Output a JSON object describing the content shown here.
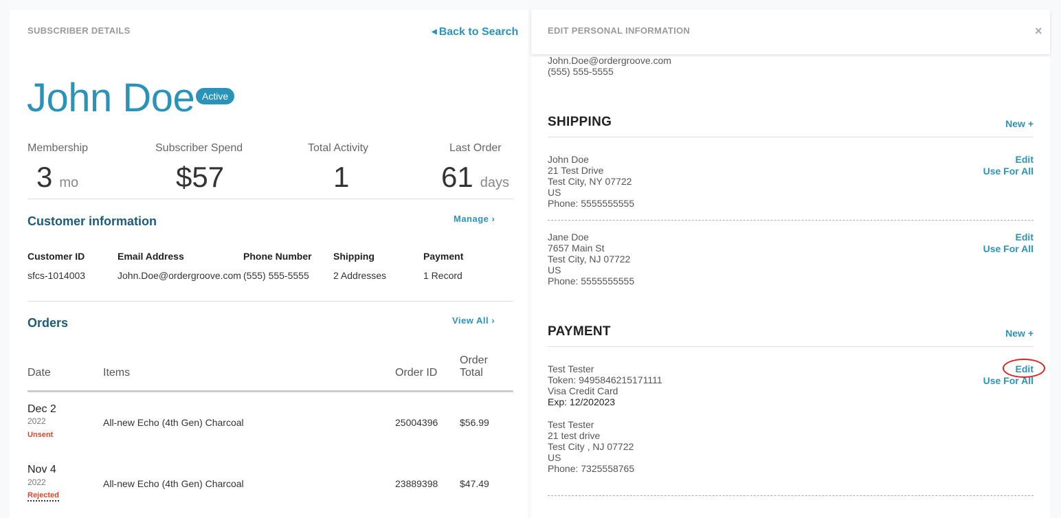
{
  "left": {
    "section_label": "SUBSCRIBER DETAILS",
    "back_link": "Back to Search",
    "name": "John Doe",
    "status": "Active",
    "stats": [
      {
        "label": "Membership",
        "value": "3",
        "unit": "mo"
      },
      {
        "label": "Subscriber Spend",
        "value": "$57",
        "unit": ""
      },
      {
        "label": "Total Activity",
        "value": "1",
        "unit": ""
      },
      {
        "label": "Last Order",
        "value": "61",
        "unit": "days"
      }
    ],
    "customer_info": {
      "title": "Customer information",
      "manage": "Manage  ›",
      "headers": [
        "Customer ID",
        "Email Address",
        "Phone Number",
        "Shipping",
        "Payment"
      ],
      "values": [
        "sfcs-1014003",
        "John.Doe@ordergroove.com",
        "(555) 555-5555",
        "2 Addresses",
        "1 Record"
      ]
    },
    "orders": {
      "title": "Orders",
      "view_all": "View All  ›",
      "headers": {
        "date": "Date",
        "items": "Items",
        "order_id": "Order ID",
        "order_total_1": "Order",
        "order_total_2": "Total"
      },
      "rows": [
        {
          "date": "Dec 2",
          "year": "2022",
          "status": "Unsent",
          "item": "All-new Echo (4th Gen) Charcoal",
          "order_id": "25004396",
          "total": "$56.99"
        },
        {
          "date": "Nov 4",
          "year": "2022",
          "status": "Rejected",
          "item": "All-new Echo (4th Gen) Charcoal",
          "order_id": "23889398",
          "total": "$47.49"
        }
      ]
    }
  },
  "right": {
    "section_label": "EDIT PERSONAL INFORMATION",
    "close": "×",
    "email": "John.Doe@ordergroove.com",
    "phone": "(555) 555-5555",
    "shipping": {
      "title": "SHIPPING",
      "new": "New +",
      "edit": "Edit",
      "use_for_all": "Use For All",
      "addresses": [
        {
          "name": "John Doe",
          "line1": "21 Test Drive",
          "city": "Test City, NY 07722",
          "country": "US",
          "phone": "Phone: 5555555555"
        },
        {
          "name": "Jane Doe",
          "line1": "7657 Main St",
          "city": "Test City, NJ 07722",
          "country": "US",
          "phone": "Phone: 5555555555"
        }
      ]
    },
    "payment": {
      "title": "PAYMENT",
      "new": "New +",
      "edit": "Edit",
      "use_for_all": "Use For All",
      "name": "Test Tester",
      "token": "Token: 9495846215171111",
      "card": "Visa Credit Card",
      "exp": "Exp: 12/202023",
      "billing": {
        "name": "Test Tester",
        "line1": "21 test drive",
        "city": "Test City , NJ 07722",
        "country": "US",
        "phone": "Phone: 7325558765"
      }
    }
  },
  "colors": {
    "accent": "#2b93b8",
    "title_dark": "#1e5b78",
    "status_red": "#d9482b",
    "highlight_circle": "#e02020"
  }
}
